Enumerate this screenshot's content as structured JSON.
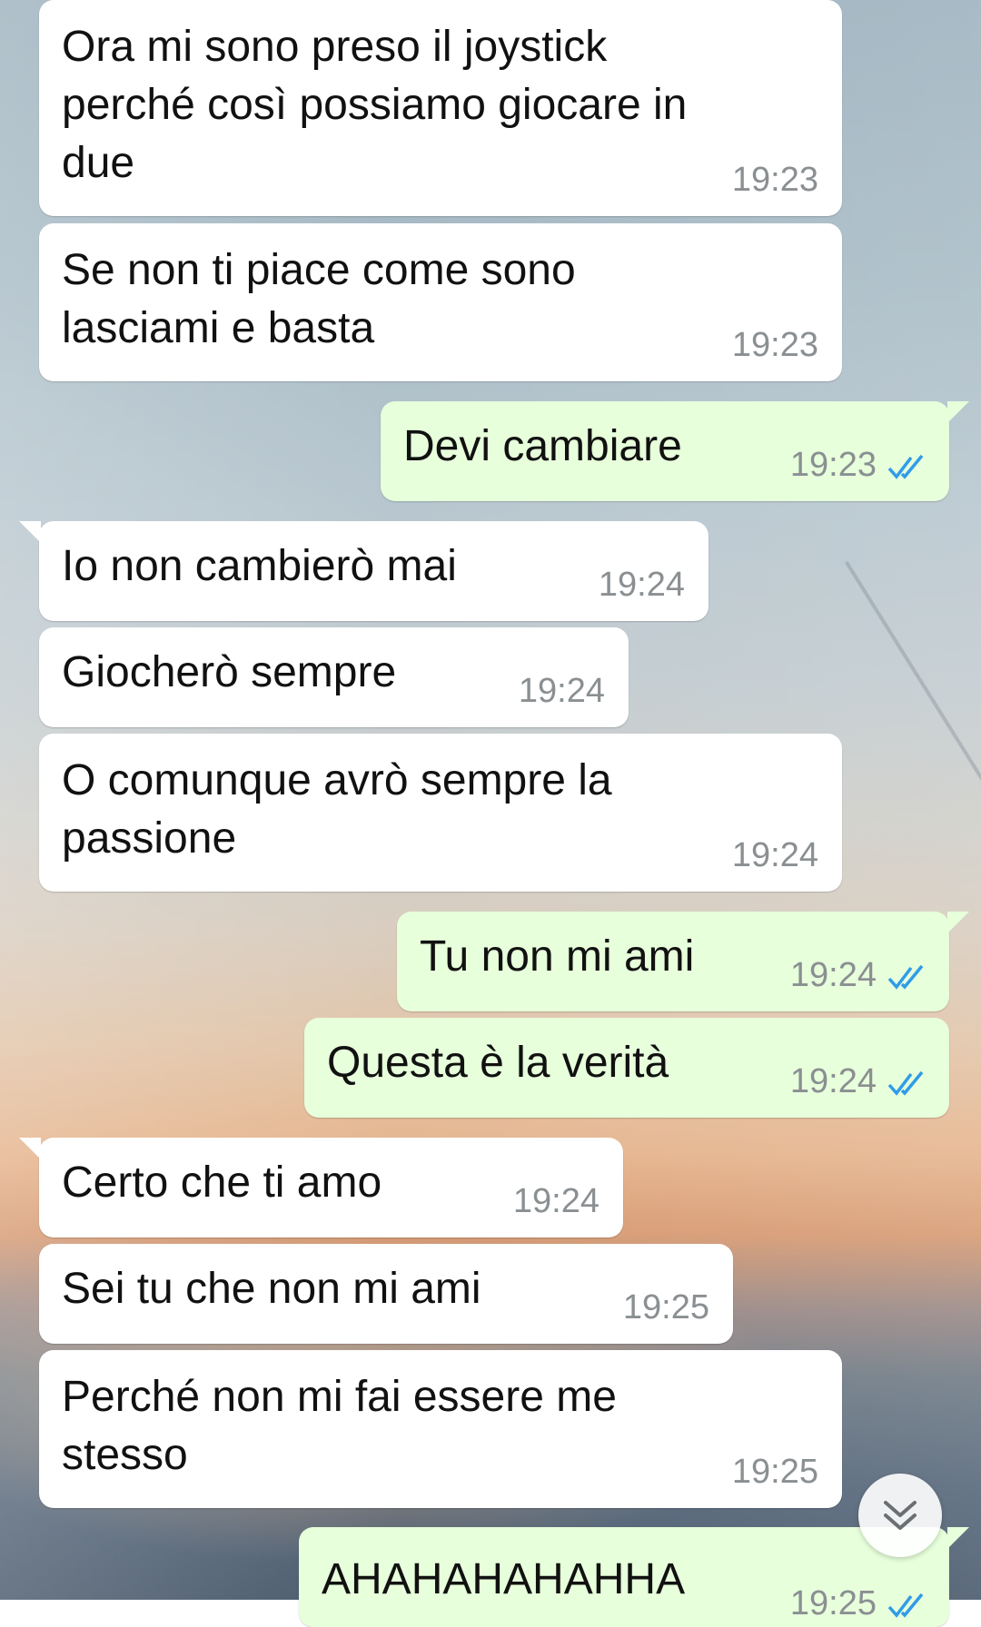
{
  "messages": [
    {
      "direction": "in",
      "text": "Ora mi sono preso il joystick\nperché così possiamo giocare in\ndue",
      "time": "19:23"
    },
    {
      "direction": "in",
      "text": "Se non ti piace come sono\nlasciami e basta",
      "time": "19:23"
    },
    {
      "direction": "out",
      "text": "Devi cambiare",
      "time": "19:23",
      "status": "read"
    },
    {
      "direction": "in",
      "text": "Io non cambierò mai",
      "time": "19:24"
    },
    {
      "direction": "in",
      "text": "Giocherò sempre",
      "time": "19:24"
    },
    {
      "direction": "in",
      "text": "O comunque avrò sempre la\npassione",
      "time": "19:24"
    },
    {
      "direction": "out",
      "text": "Tu non mi ami",
      "time": "19:24",
      "status": "read"
    },
    {
      "direction": "out",
      "text": "Questa è la verità",
      "time": "19:24",
      "status": "read"
    },
    {
      "direction": "in",
      "text": "Certo che ti amo",
      "time": "19:24"
    },
    {
      "direction": "in",
      "text": "Sei tu che non mi ami",
      "time": "19:25"
    },
    {
      "direction": "in",
      "text": "Perché non mi fai essere me\nstesso",
      "time": "19:25"
    },
    {
      "direction": "out",
      "text": "AHAHAHAHAHHA",
      "time": "19:25",
      "status": "read"
    }
  ],
  "scroll_button": {
    "icon": "double-chevron-down-icon"
  },
  "colors": {
    "incoming_bubble": "#ffffff",
    "outgoing_bubble": "#e7ffdb",
    "read_ticks": "#2f9ce8",
    "timestamp": "#8a8f92"
  }
}
